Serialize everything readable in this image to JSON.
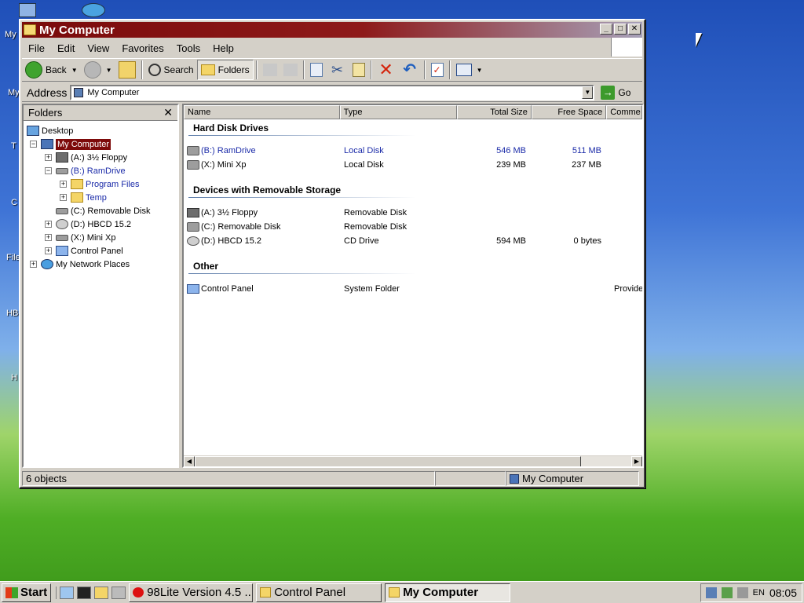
{
  "desktop": {
    "icon_labels": [
      "My",
      "My",
      "T",
      "C",
      "File",
      "HB",
      "H"
    ]
  },
  "window": {
    "title": "My Computer",
    "buttons": {
      "minimize": "_",
      "maximize": "□",
      "close": "✕"
    }
  },
  "menu": [
    "File",
    "Edit",
    "View",
    "Favorites",
    "Tools",
    "Help"
  ],
  "toolbar": {
    "back": "Back",
    "search": "Search",
    "folders": "Folders"
  },
  "address": {
    "label": "Address",
    "value": "My Computer",
    "go": "Go"
  },
  "folders_pane": {
    "title": "Folders",
    "close": "✕",
    "tree": [
      {
        "label": "Desktop"
      },
      {
        "label": "My Computer"
      },
      {
        "label": "(A:) 3½ Floppy"
      },
      {
        "label": "(B:) RamDrive"
      },
      {
        "label": "Program Files"
      },
      {
        "label": "Temp"
      },
      {
        "label": "(C:) Removable Disk"
      },
      {
        "label": "(D:) HBCD 15.2"
      },
      {
        "label": "(X:) Mini Xp"
      },
      {
        "label": "Control Panel"
      },
      {
        "label": "My Network Places"
      }
    ]
  },
  "list": {
    "columns": [
      "Name",
      "Type",
      "Total Size",
      "Free Space",
      "Comme"
    ],
    "groups": {
      "hdd": "Hard Disk Drives",
      "removable": "Devices with Removable Storage",
      "other": "Other"
    },
    "rows": [
      {
        "name": "(B:) RamDrive",
        "type": "Local Disk",
        "total": "546 MB",
        "free": "511 MB",
        "comment": ""
      },
      {
        "name": "(X:) Mini Xp",
        "type": "Local Disk",
        "total": "239 MB",
        "free": "237 MB",
        "comment": ""
      },
      {
        "name": "(A:) 3½ Floppy",
        "type": "Removable Disk",
        "total": "",
        "free": "",
        "comment": ""
      },
      {
        "name": "(C:) Removable Disk",
        "type": "Removable Disk",
        "total": "",
        "free": "",
        "comment": ""
      },
      {
        "name": "(D:) HBCD 15.2",
        "type": "CD Drive",
        "total": "594 MB",
        "free": "0 bytes",
        "comment": ""
      },
      {
        "name": "Control Panel",
        "type": "System Folder",
        "total": "",
        "free": "",
        "comment": "Provide"
      }
    ]
  },
  "status": {
    "objects": "6 objects",
    "location": "My Computer"
  },
  "taskbar": {
    "start": "Start",
    "tasks": [
      "98Lite Version 4.5 ...",
      "Control Panel",
      "My Computer"
    ],
    "tray_lang": "EN",
    "clock": "08:05"
  },
  "colors": {
    "title_active": "#7a0b0b",
    "selection": "#7d0a0a",
    "link_blue": "#1a2aa8"
  }
}
